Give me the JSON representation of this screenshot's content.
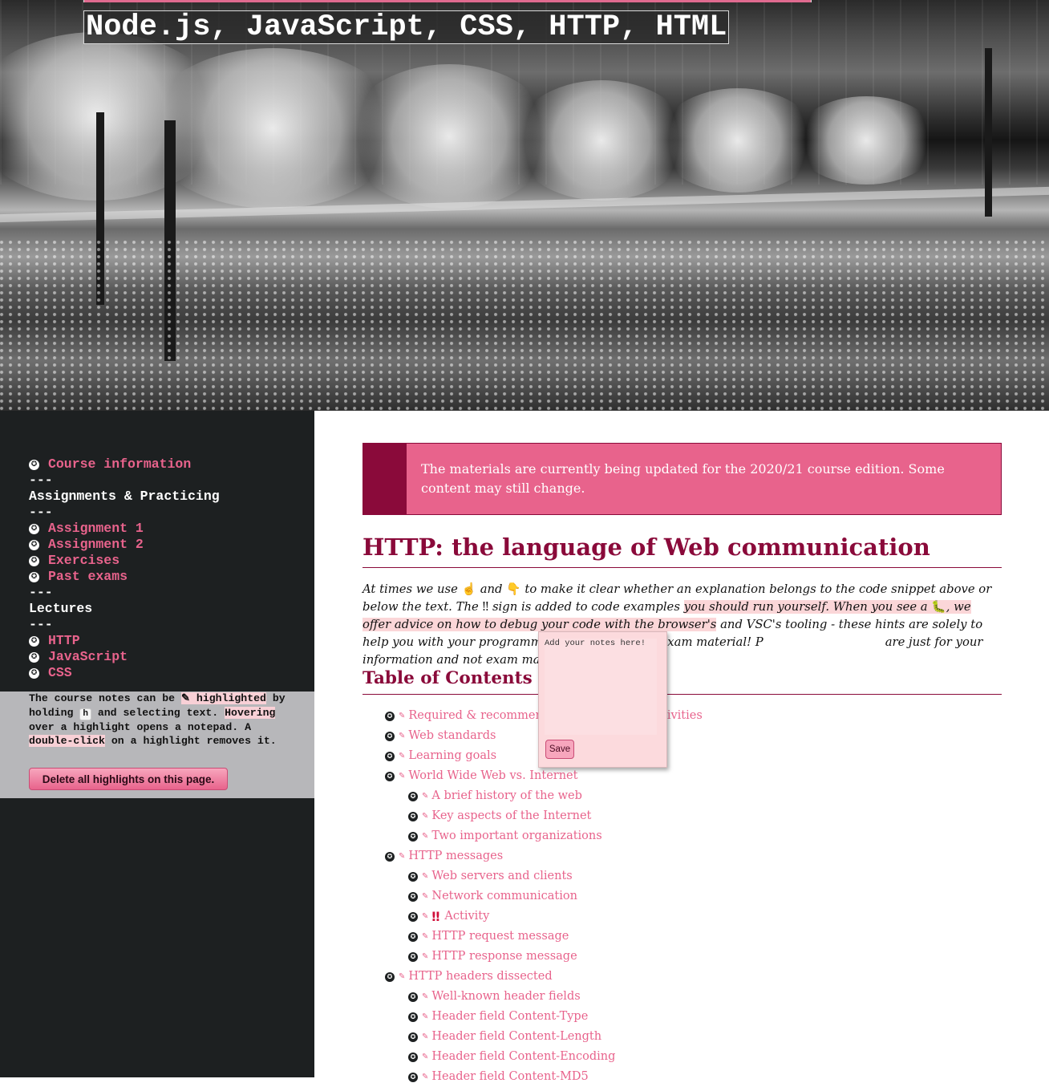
{
  "header": {
    "site_title": "Node.js, JavaScript, CSS, HTTP, HTML"
  },
  "sidebar": {
    "nav": [
      {
        "type": "link",
        "label": "Course information"
      },
      {
        "type": "sep",
        "label": "---"
      },
      {
        "type": "heading",
        "label": "Assignments & Practicing"
      },
      {
        "type": "sep",
        "label": "---"
      },
      {
        "type": "link",
        "label": "Assignment 1"
      },
      {
        "type": "link",
        "label": "Assignment 2"
      },
      {
        "type": "link",
        "label": "Exercises"
      },
      {
        "type": "link",
        "label": "Past exams"
      },
      {
        "type": "sep",
        "label": "---"
      },
      {
        "type": "heading",
        "label": "Lectures"
      },
      {
        "type": "sep",
        "label": "---"
      },
      {
        "type": "link",
        "label": "HTTP"
      },
      {
        "type": "link",
        "label": "JavaScript"
      },
      {
        "type": "link",
        "label": "CSS"
      }
    ],
    "highlight_help": {
      "t1": "The course notes can be ",
      "mark1": "✎ highlighted",
      "t2": " by holding ",
      "key": "h",
      "t3": " and selecting text. ",
      "mark2": "Hovering",
      "t4": " over a highlight opens a notepad. A ",
      "mark3": "double-click",
      "t5": " on a highlight removes it."
    },
    "delete_button": "Delete all highlights on this page."
  },
  "main": {
    "notice": "The materials are currently being updated for the 2020/21 course edition. Some content may still change.",
    "title": "HTTP: the language of Web communication",
    "intro": {
      "p1": "At times we use ",
      "emoji_up": "☝",
      "p2": " and ",
      "emoji_down": "👇",
      "p3": " to make it clear whether an explanation belongs to the code snippet above or below the text. The ",
      "bang": "‼",
      "p4": " sign is added to code examples ",
      "hl1": "you should run yourself. When you see a ",
      "bug": "🐛",
      "hl2": ", we offer advice on how to debug your code with the browser's",
      "p5": " and VSC's tooling - these hints are solely to help you with your programming project and not exam material! P",
      "p6": "are just for your information and not exam material."
    },
    "toc_title": "Table of Contents",
    "toc": [
      {
        "level": 1,
        "label": "Required & recommended readings and activities"
      },
      {
        "level": 1,
        "label": "Web standards"
      },
      {
        "level": 1,
        "label": "Learning goals"
      },
      {
        "level": 1,
        "label": "World Wide Web vs. Internet"
      },
      {
        "level": 2,
        "label": "A brief history of the web"
      },
      {
        "level": 2,
        "label": "Key aspects of the Internet"
      },
      {
        "level": 2,
        "label": "Two important organizations"
      },
      {
        "level": 1,
        "label": "HTTP messages"
      },
      {
        "level": 2,
        "label": "Web servers and clients"
      },
      {
        "level": 2,
        "label": "Network communication"
      },
      {
        "level": 2,
        "label": "Activity",
        "bang": "‼"
      },
      {
        "level": 2,
        "label": "HTTP request message"
      },
      {
        "level": 2,
        "label": "HTTP response message"
      },
      {
        "level": 1,
        "label": "HTTP headers dissected"
      },
      {
        "level": 2,
        "label": "Well-known header fields"
      },
      {
        "level": 2,
        "label": "Header field Content-Type"
      },
      {
        "level": 2,
        "label": "Header field Content-Length"
      },
      {
        "level": 2,
        "label": "Header field Content-Encoding"
      },
      {
        "level": 2,
        "label": "Header field Content-MD5"
      }
    ]
  },
  "notepad": {
    "placeholder": "Add your notes here!",
    "save_label": "Save"
  },
  "colors": {
    "accent": "#e8638c",
    "dark_accent": "#8a0a3a",
    "sidebar_bg": "#1d2021",
    "highlight_bg": "#fbd6d8"
  },
  "icons": {
    "nav_bullet": "star-circle-icon",
    "toc_pen": "pencil-icon"
  }
}
